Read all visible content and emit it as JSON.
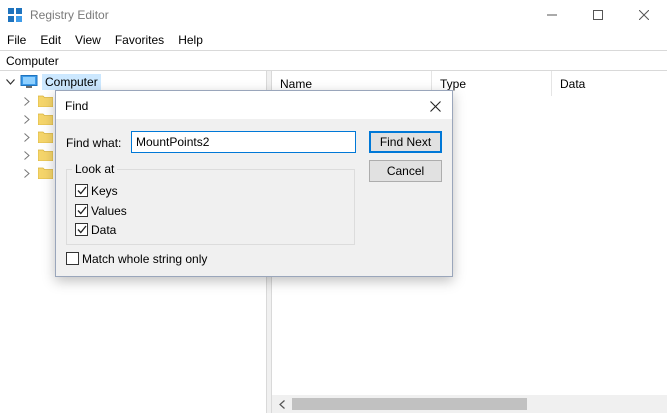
{
  "window": {
    "title": "Registry Editor",
    "controls": [
      "minimize-icon",
      "maximize-icon",
      "close-icon"
    ]
  },
  "menu": {
    "items": [
      "File",
      "Edit",
      "View",
      "Favorites",
      "Help"
    ]
  },
  "address": {
    "path": "Computer"
  },
  "tree": {
    "root_label": "Computer",
    "root_expanded": true,
    "child_count": 5
  },
  "list": {
    "columns": [
      "Name",
      "Type",
      "Data"
    ]
  },
  "find_dialog": {
    "title": "Find",
    "find_what_label": "Find what:",
    "find_what_value": "MountPoints2",
    "find_next_label": "Find Next",
    "cancel_label": "Cancel",
    "look_at_label": "Look at",
    "options": [
      {
        "label": "Keys",
        "checked": true
      },
      {
        "label": "Values",
        "checked": true
      },
      {
        "label": "Data",
        "checked": true
      }
    ],
    "match_whole": {
      "label": "Match whole string only",
      "checked": false
    }
  },
  "colors": {
    "accent": "#0078d7",
    "selection": "#cce8ff",
    "folder": "#f5d56b",
    "dialog_bg": "#f0f0f0"
  }
}
